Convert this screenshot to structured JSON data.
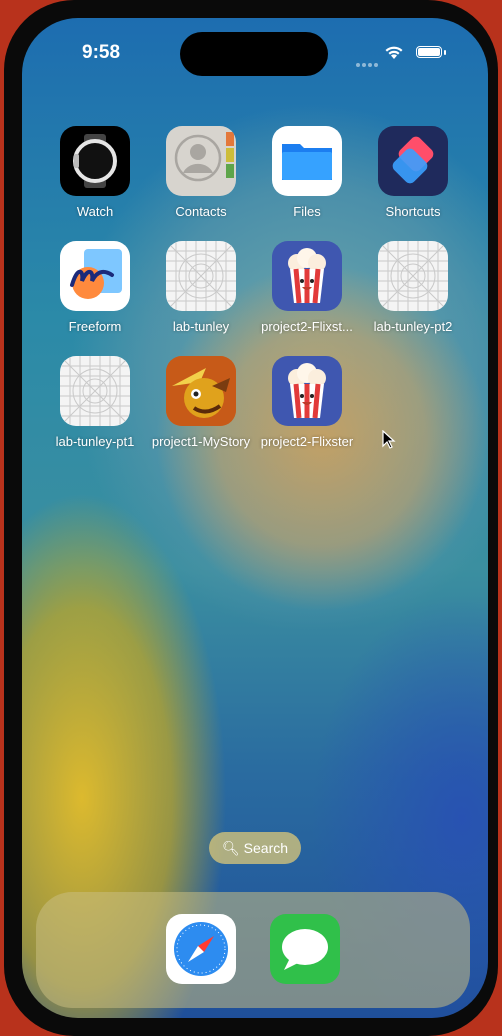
{
  "status_bar": {
    "time": "9:58"
  },
  "apps": [
    {
      "label": "Watch",
      "icon": "watch-icon"
    },
    {
      "label": "Contacts",
      "icon": "contacts-icon"
    },
    {
      "label": "Files",
      "icon": "files-icon"
    },
    {
      "label": "Shortcuts",
      "icon": "shortcuts-icon"
    },
    {
      "label": "Freeform",
      "icon": "freeform-icon"
    },
    {
      "label": "lab-tunley",
      "icon": "placeholder-app-icon"
    },
    {
      "label": "project2-Flixst...",
      "icon": "popcorn-icon"
    },
    {
      "label": "lab-tunley-pt2",
      "icon": "placeholder-app-icon"
    },
    {
      "label": "lab-tunley-pt1",
      "icon": "placeholder-app-icon"
    },
    {
      "label": "project1-MyStory",
      "icon": "mystory-icon"
    },
    {
      "label": "project2-Flixster",
      "icon": "popcorn-icon"
    }
  ],
  "search": {
    "label": "Search"
  },
  "dock": [
    {
      "name": "Safari",
      "icon": "safari-icon"
    },
    {
      "name": "Messages",
      "icon": "messages-icon"
    }
  ]
}
